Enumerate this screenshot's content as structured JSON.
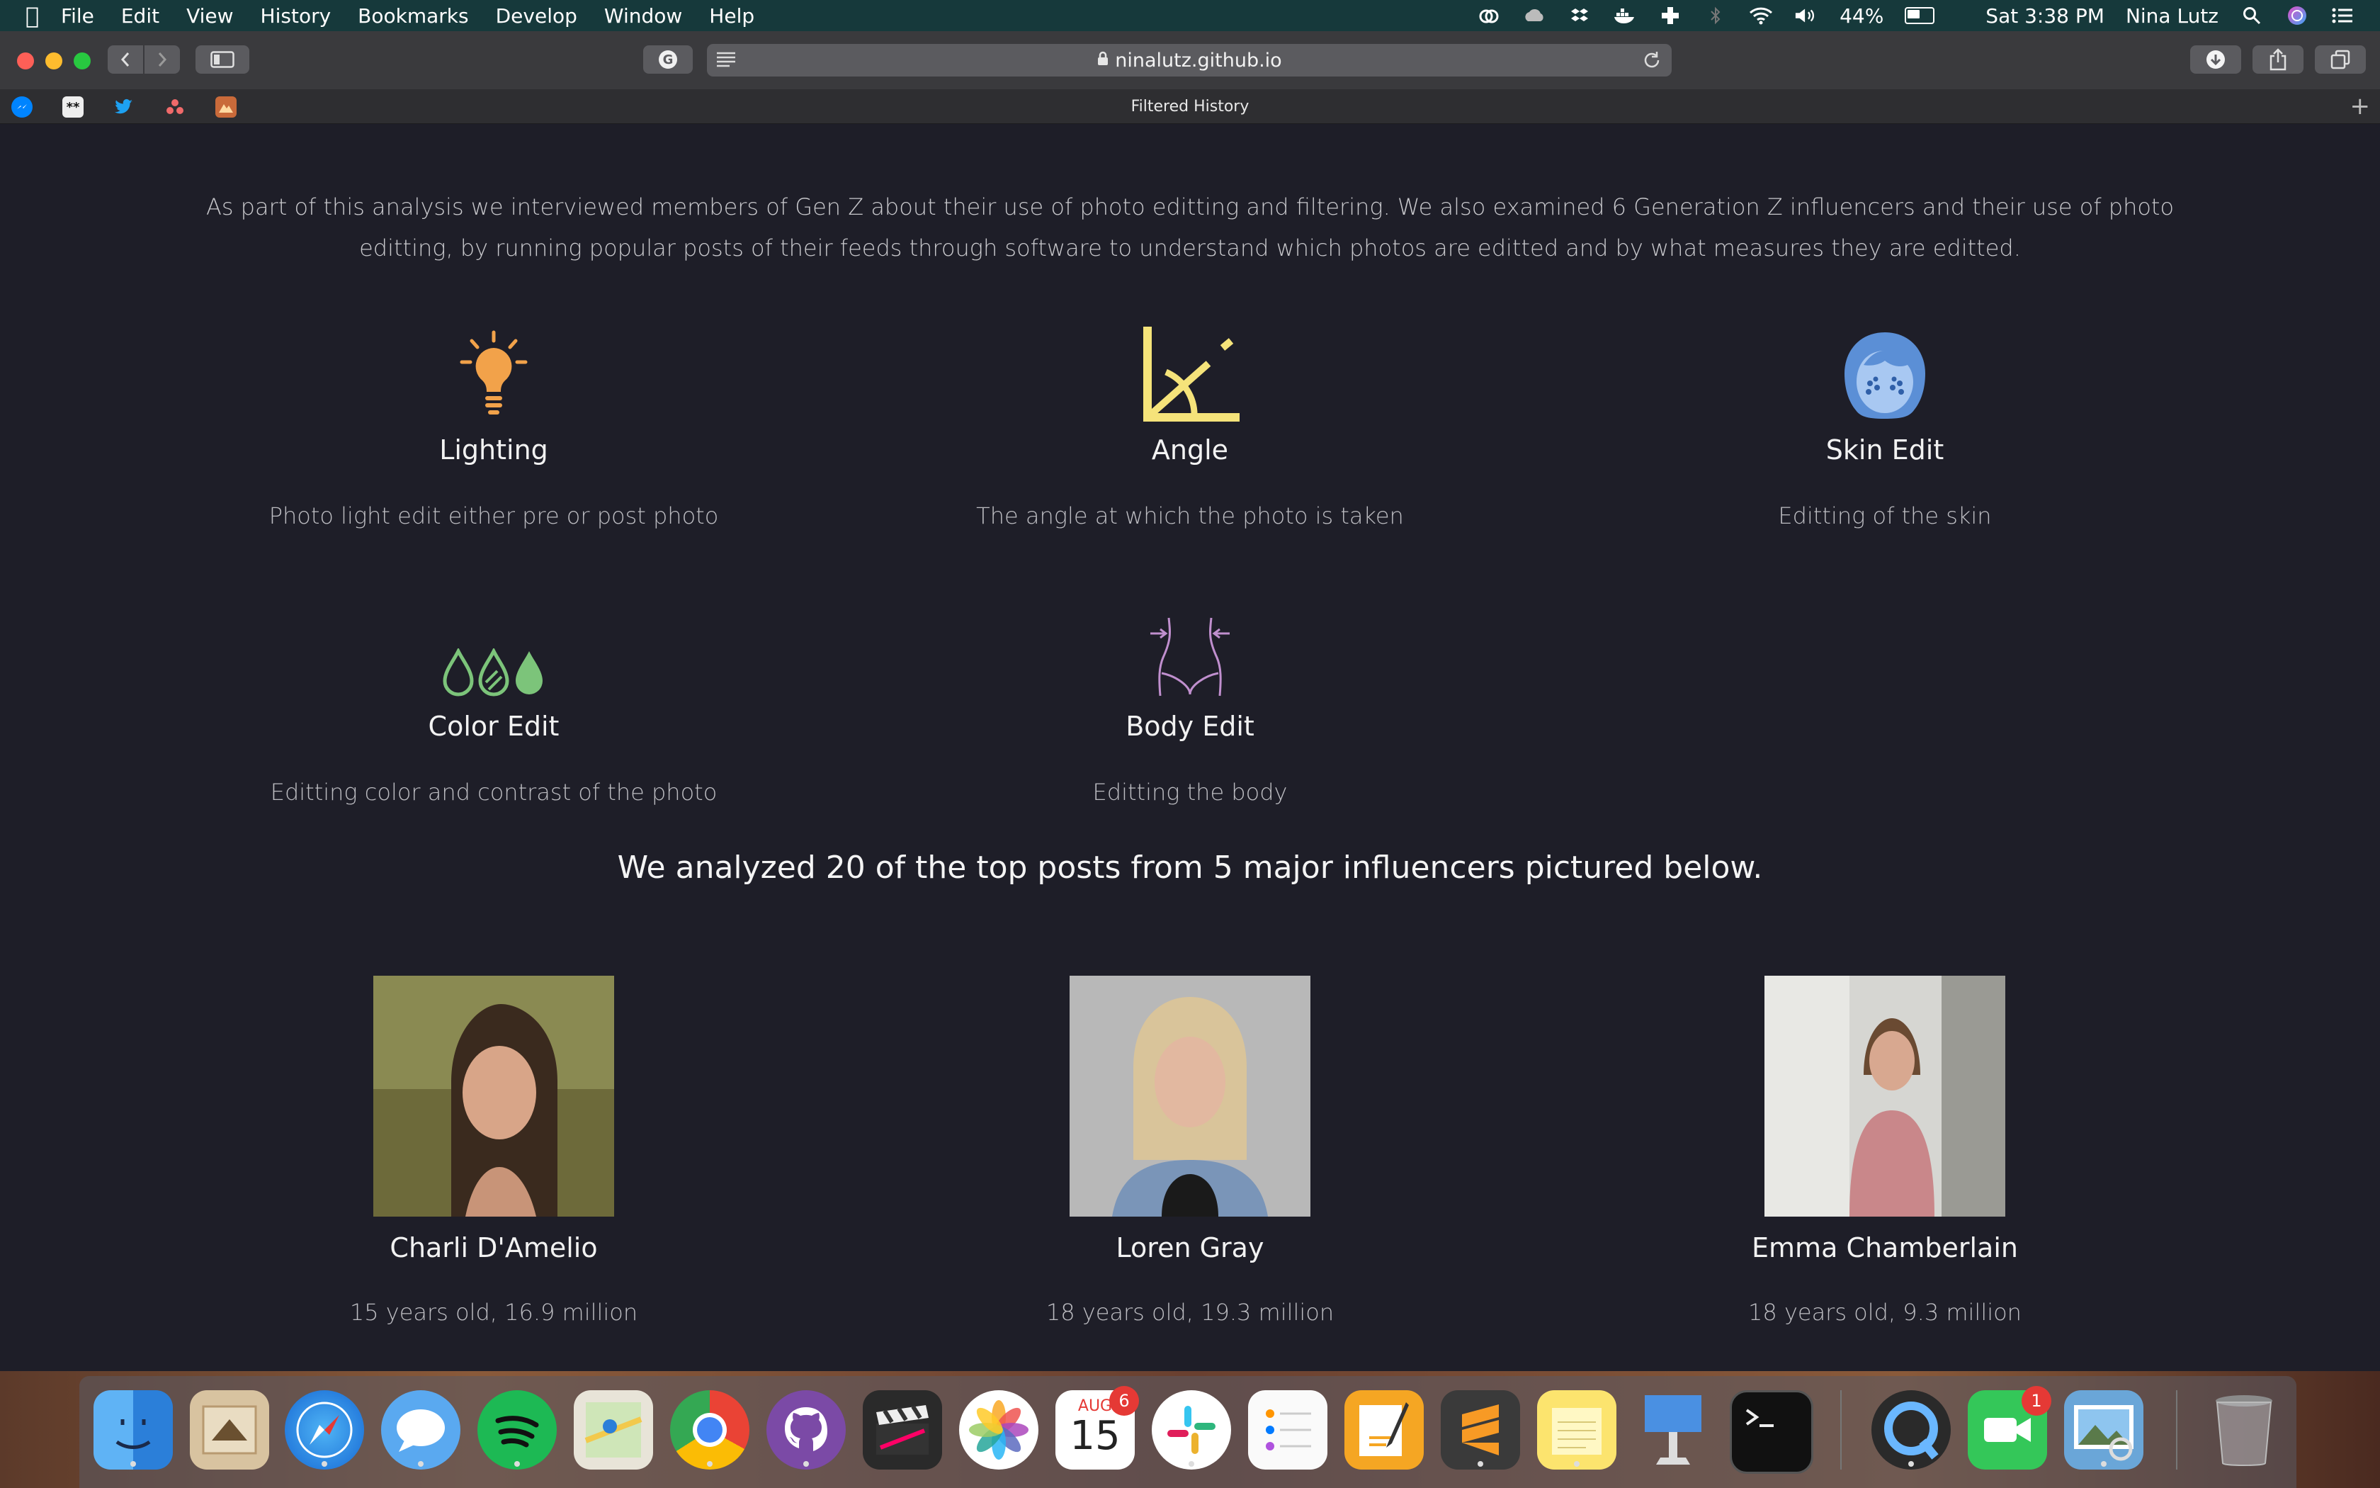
{
  "menubar": {
    "app": "Safari",
    "items": [
      "File",
      "Edit",
      "View",
      "History",
      "Bookmarks",
      "Develop",
      "Window",
      "Help"
    ],
    "battery_percent": "44%",
    "clock": "Sat 3:38 PM",
    "user": "Nina Lutz"
  },
  "browser": {
    "url": "ninalutz.github.io",
    "tab_title": "Filtered History"
  },
  "content": {
    "intro": "As part of this analysis we interviewed members of Gen Z about their use of photo editting and filtering. We also examined 6 Generation Z influencers and their use of photo editting, by running popular posts of their feeds through software to understand which photos are editted and by what measures they are editted.",
    "features": [
      {
        "title": "Lighting",
        "desc": "Photo light edit either pre or post photo",
        "icon": "lightbulb-icon",
        "color": "#f2a24a"
      },
      {
        "title": "Angle",
        "desc": "The angle at which the photo is taken",
        "icon": "angle-icon",
        "color": "#f5e37a"
      },
      {
        "title": "Skin Edit",
        "desc": "Editting of the skin",
        "icon": "face-icon",
        "color": "#5b8fd6"
      },
      {
        "title": "Color Edit",
        "desc": "Editting color and contrast of the photo",
        "icon": "drops-icon",
        "color": "#7cc47a"
      },
      {
        "title": "Body Edit",
        "desc": "Editting the body",
        "icon": "body-icon",
        "color": "#c08fce"
      }
    ],
    "summary": "We analyzed 20 of the top posts from 5 major influencers pictured below.",
    "influencers": [
      {
        "name": "Charli D'Amelio",
        "stats": "15 years old, 16.9 million"
      },
      {
        "name": "Loren Gray",
        "stats": "18 years old, 19.3 million"
      },
      {
        "name": "Emma Chamberlain",
        "stats": "18 years old, 9.3 million"
      }
    ]
  },
  "dock": {
    "calendar_month": "AUG",
    "calendar_day": "15",
    "calendar_badge": "6",
    "facetime_badge": "1"
  }
}
